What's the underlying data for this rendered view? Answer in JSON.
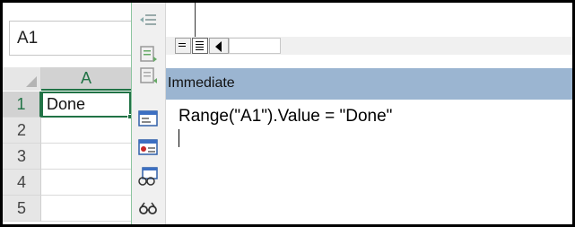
{
  "excel": {
    "name_box_value": "A1",
    "column_header": "A",
    "rows": [
      {
        "num": "1",
        "value": "Done"
      },
      {
        "num": "2",
        "value": ""
      },
      {
        "num": "3",
        "value": ""
      },
      {
        "num": "4",
        "value": ""
      },
      {
        "num": "5",
        "value": ""
      }
    ]
  },
  "vbe": {
    "immediate_title": "Immediate",
    "immediate_code": "Range(\"A1\").Value = \"Done\"",
    "toolbar_icons": [
      "outdent-icon",
      "comment-block-icon",
      "uncomment-block-icon",
      "userform-icon",
      "breakpoint-icon",
      "locals-window-icon",
      "watch-icon"
    ]
  },
  "colors": {
    "excel_green": "#217346",
    "immediate_title_bg": "#9bb5d1"
  }
}
